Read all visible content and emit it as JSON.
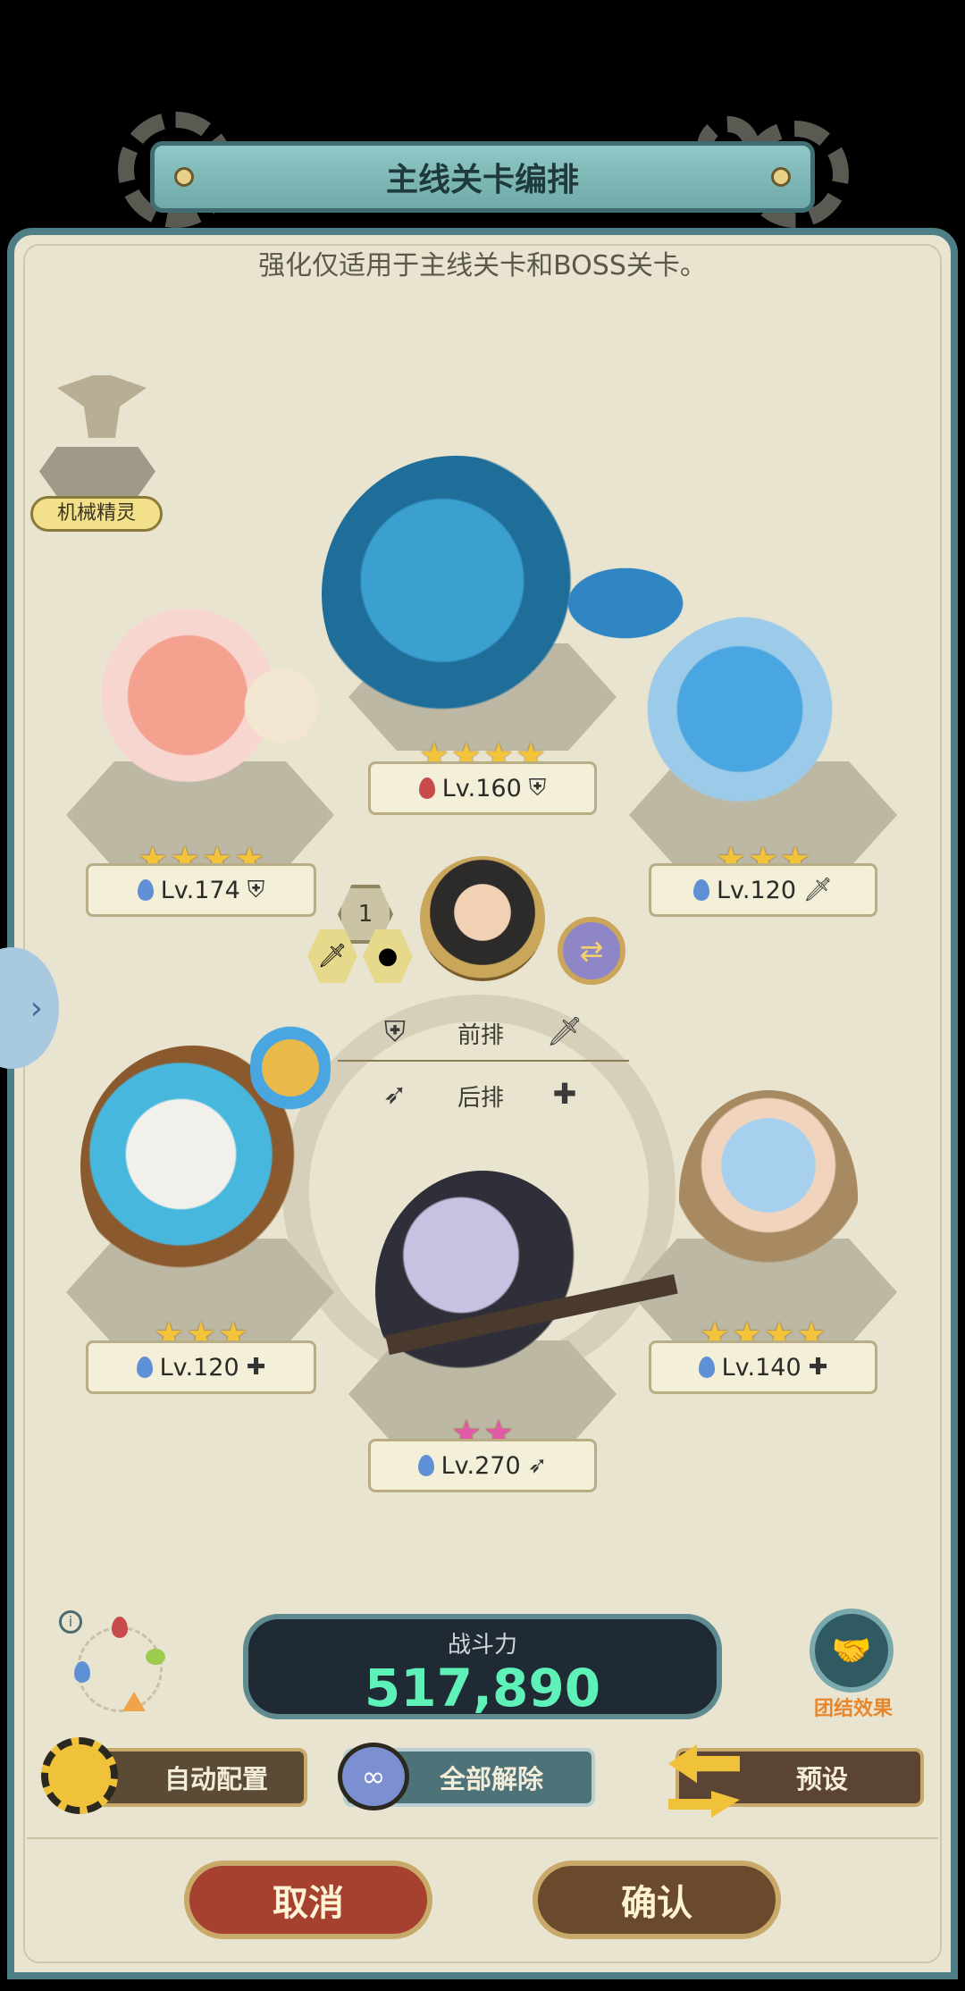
{
  "header": {
    "title": "主线关卡编排",
    "subtitle": "强化仅适用于主线关卡和BOSS关卡。"
  },
  "pet": {
    "label": "机械精灵"
  },
  "slots": [
    {
      "id": "front-top",
      "level": "Lv.160",
      "stars": 4,
      "star_color": "gold",
      "element": "fire",
      "role": "shield"
    },
    {
      "id": "left-top",
      "level": "Lv.174",
      "stars": 4,
      "star_color": "gold",
      "element": "water",
      "role": "shield"
    },
    {
      "id": "right-top",
      "level": "Lv.120",
      "stars": 3,
      "star_color": "gold",
      "element": "water",
      "role": "sword"
    },
    {
      "id": "left-bottom",
      "level": "Lv.120",
      "stars": 3,
      "star_color": "gold",
      "element": "water",
      "role": "healer"
    },
    {
      "id": "right-bottom",
      "level": "Lv.140",
      "stars": 4,
      "star_color": "gold",
      "element": "water",
      "role": "healer"
    },
    {
      "id": "center-bottom",
      "level": "Lv.270",
      "stars": 2,
      "star_color": "pink",
      "element": "water",
      "role": "ranged"
    }
  ],
  "leader": {
    "slot_number": "1"
  },
  "formation": {
    "front_label": "前排",
    "back_label": "后排"
  },
  "power": {
    "label": "战斗力",
    "value": "517,890"
  },
  "synergy": {
    "label": "团结效果"
  },
  "buttons": {
    "auto": "自动配置",
    "clear": "全部解除",
    "preset": "预设",
    "cancel": "取消",
    "confirm": "确认"
  },
  "colors": {
    "accent_teal": "#4e7f86",
    "power_green": "#5ef2b8",
    "cancel_red": "#a5412e",
    "confirm_brown": "#6a4a2c"
  }
}
